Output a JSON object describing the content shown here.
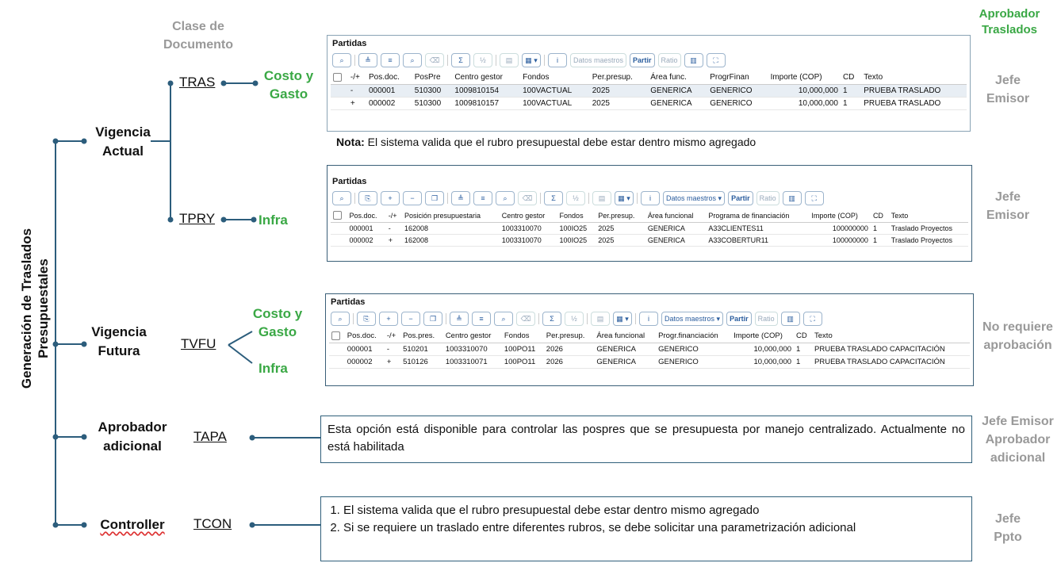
{
  "root_label": "Generación de Traslados Presupuestales",
  "headers": {
    "clase": "Clase de Documento",
    "aprobador": "Aprobador Traslados"
  },
  "branches": {
    "vigencia_actual": "Vigencia Actual",
    "vigencia_futura": "Vigencia Futura",
    "aprobador_adicional": "Aprobador adicional",
    "controller": "Controller"
  },
  "codes": {
    "tras": "TRAS",
    "tpry": "TPRY",
    "tvfu": "TVFU",
    "tapa": "TAPA",
    "tcon": "TCON"
  },
  "categories": {
    "costo_gasto": "Costo y Gasto",
    "infra": "Infra"
  },
  "approvers": {
    "tras": "Jefe Emisor",
    "tpry": "Jefe Emisor",
    "tvfu": "No requiere aprobación",
    "tapa": "Jefe Emisor Aprobador adicional",
    "tcon": "Jefe Ppto"
  },
  "nota": {
    "bold": "Nota:",
    "text": " El sistema valida que el rubro presupuestal debe estar dentro mismo agregado"
  },
  "tapa_text": "Esta opción está disponible para controlar las pospres que se presupuesta por manejo centralizado. Actualmente no está habilitada",
  "tcon_items": [
    "El sistema valida que el rubro presupuestal debe estar dentro mismo agregado",
    "Si se requiere un traslado entre diferentes rubros, se debe solicitar una parametrización adicional"
  ],
  "toolbar": {
    "datos_maestros": "Datos maestros",
    "partir": "Partir",
    "ratio": "Ratio"
  },
  "table1": {
    "title": "Partidas",
    "headers": [
      "-/+",
      "Pos.doc.",
      "PosPre",
      "Centro gestor",
      "Fondos",
      "Per.presup.",
      "Área func.",
      "ProgrFinan",
      "Importe (COP)",
      "CD",
      "Texto"
    ],
    "rows": [
      [
        "-",
        "000001",
        "510300",
        "1009810154",
        "100VACTUAL",
        "2025",
        "GENERICA",
        "GENERICO",
        "10,000,000",
        "1",
        "PRUEBA TRASLADO"
      ],
      [
        "+",
        "000002",
        "510300",
        "1009810157",
        "100VACTUAL",
        "2025",
        "GENERICA",
        "GENERICO",
        "10,000,000",
        "1",
        "PRUEBA TRASLADO"
      ]
    ]
  },
  "table2": {
    "title": "Partidas",
    "headers": [
      "Pos.doc.",
      "-/+",
      "Posición presupuestaria",
      "Centro gestor",
      "Fondos",
      "Per.presup.",
      "Área funcional",
      "Programa de financiación",
      "Importe (COP)",
      "CD",
      "Texto"
    ],
    "rows": [
      [
        "000001",
        "-",
        "162008",
        "1003310070",
        "100IO25",
        "2025",
        "GENERICA",
        "A33CLIENTES11",
        "100000000",
        "1",
        "Traslado Proyectos"
      ],
      [
        "000002",
        "+",
        "162008",
        "1003310070",
        "100IO25",
        "2025",
        "GENERICA",
        "A33COBERTUR11",
        "100000000",
        "1",
        "Traslado Proyectos"
      ]
    ]
  },
  "table3": {
    "title": "Partidas",
    "headers": [
      "Pos.doc.",
      "-/+",
      "Pos.pres.",
      "Centro gestor",
      "Fondos",
      "Per.presup.",
      "Área funcional",
      "Progr.financiación",
      "Importe (COP)",
      "CD",
      "Texto"
    ],
    "rows": [
      [
        "000001",
        "-",
        "510201",
        "1003310070",
        "100PO11",
        "2026",
        "GENERICA",
        "GENERICO",
        "10,000,000",
        "1",
        "PRUEBA TRASLADO CAPACITACIÓN"
      ],
      [
        "000002",
        "+",
        "510126",
        "1003310071",
        "100PO11",
        "2026",
        "GENERICA",
        "GENERICO",
        "10,000,000",
        "1",
        "PRUEBA TRASLADO CAPACITACIÓN"
      ]
    ]
  }
}
